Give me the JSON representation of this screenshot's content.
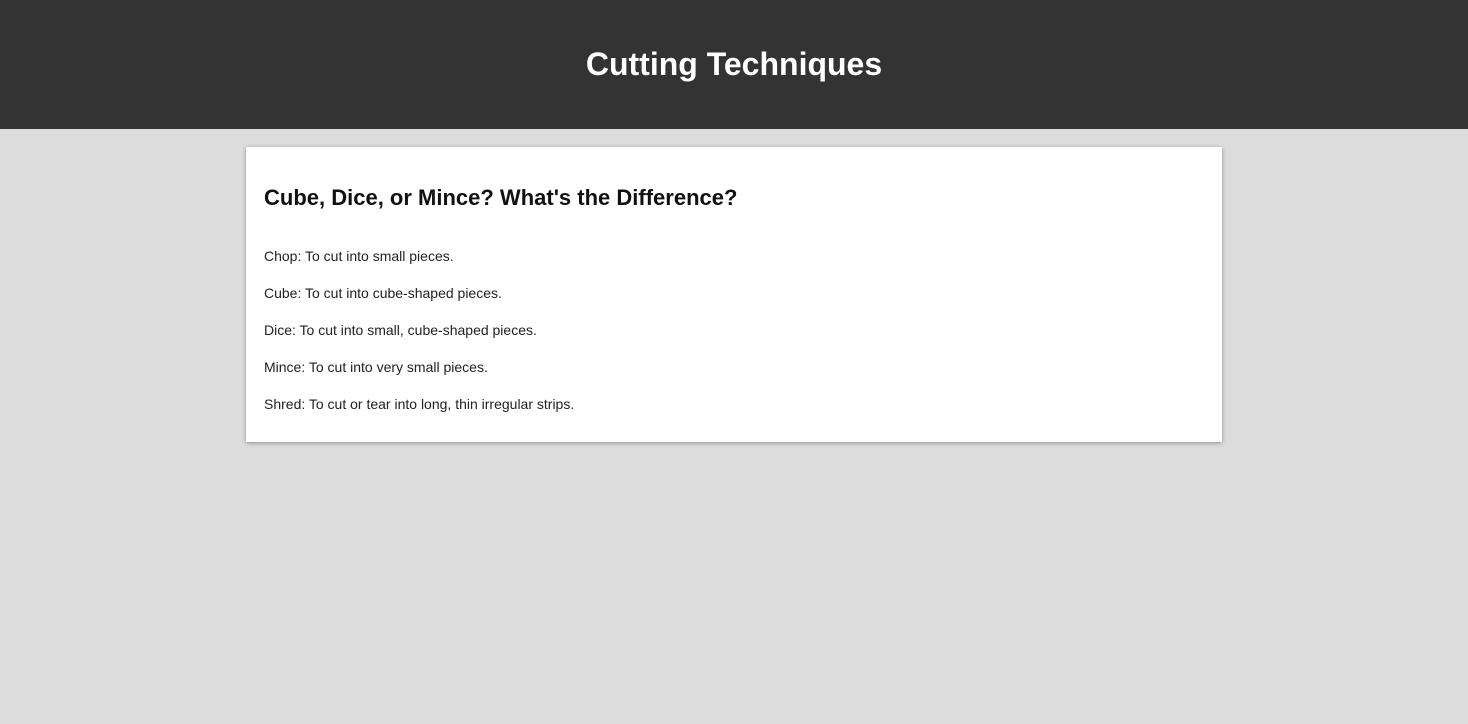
{
  "header": {
    "title": "Cutting Techniques",
    "background": "#333333"
  },
  "card": {
    "heading": "Cube, Dice, or Mince? What's the Difference?",
    "items": [
      "Chop: To cut into small pieces.",
      "Cube: To cut into cube-shaped pieces.",
      "Dice: To cut into small, cube-shaped pieces.",
      "Mince: To cut into very small pieces.",
      "Shred: To cut or tear into long, thin irregular strips."
    ]
  },
  "colors": {
    "page_background": "#dcdcdc",
    "card_background": "#ffffff"
  }
}
